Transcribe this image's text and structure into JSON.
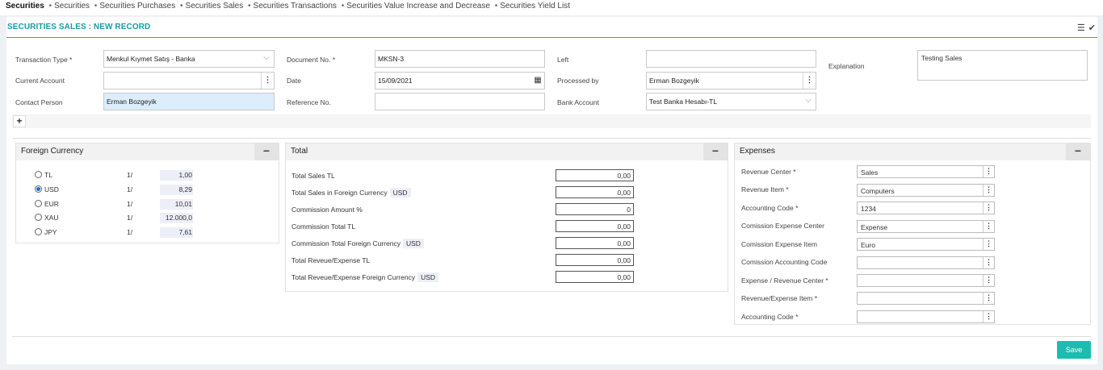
{
  "nav": {
    "first": "Securities",
    "items": [
      "Securities",
      "Securities Purchases",
      "Securities Sales",
      "Securities Transactions",
      "Securities Value Increase and Decrease",
      "Securities Yield List"
    ]
  },
  "page": {
    "title": "SECURITIES SALES : NEW RECORD"
  },
  "form": {
    "transaction_type_label": "Transaction Type *",
    "transaction_type_value": "Menkul Kıymet Satış - Banka",
    "current_account_label": "Current Account",
    "current_account_value": "",
    "contact_person_label": "Contact Person",
    "contact_person_value": "Erman Bozgeyik",
    "document_no_label": "Document No. *",
    "document_no_value": "MKSN-3",
    "date_label": "Date",
    "date_value": "15/09/2021",
    "reference_no_label": "Reference No.",
    "reference_no_value": "",
    "left_label": "Left",
    "left_value": "",
    "processed_by_label": "Processed by",
    "processed_by_value": "Erman Bozgeyik",
    "bank_account_label": "Bank Account",
    "bank_account_value": "Test Banka Hesabı-TL",
    "explanation_label": "Explanation",
    "explanation_value": "Testing Sales"
  },
  "foreign_currency": {
    "title": "Foreign Currency",
    "rows": [
      {
        "code": "TL",
        "unit": "1/",
        "value": "1,00",
        "selected": false
      },
      {
        "code": "USD",
        "unit": "1/",
        "value": "8,29",
        "selected": true
      },
      {
        "code": "EUR",
        "unit": "1/",
        "value": "10,01",
        "selected": false
      },
      {
        "code": "XAU",
        "unit": "1/",
        "value": "12.000,0",
        "selected": false
      },
      {
        "code": "JPY",
        "unit": "1/",
        "value": "7,61",
        "selected": false
      }
    ]
  },
  "total": {
    "title": "Total",
    "rows": [
      {
        "label": "Total Sales TL",
        "currency": "",
        "value": "0,00"
      },
      {
        "label": "Total Sales in Foreign Currency",
        "currency": "USD",
        "value": "0,00"
      },
      {
        "label": "Commission Amount %",
        "currency": "",
        "value": "0"
      },
      {
        "label": "Commission Total TL",
        "currency": "",
        "value": "0,00"
      },
      {
        "label": "Commission Total Foreign Currency",
        "currency": "USD",
        "value": "0,00"
      },
      {
        "label": "Total Reveue/Expense TL",
        "currency": "",
        "value": "0,00"
      },
      {
        "label": "Total Reveue/Expense Foreign Currency",
        "currency": "USD",
        "value": "0,00"
      }
    ]
  },
  "expenses": {
    "title": "Expenses",
    "rows": [
      {
        "label": "Revenue Center *",
        "value": "Sales"
      },
      {
        "label": "Revenue Item *",
        "value": "Computers"
      },
      {
        "label": "Accounting Code *",
        "value": "1234"
      },
      {
        "label": "Comission Expense Center",
        "value": "Expense"
      },
      {
        "label": "Comission Expense Item",
        "value": "Euro"
      },
      {
        "label": "Comission Accounting Code",
        "value": ""
      },
      {
        "label": "Expense / Revenue Center *",
        "value": ""
      },
      {
        "label": "Revenue/Expense Item *",
        "value": ""
      },
      {
        "label": "Accounting Code *",
        "value": ""
      }
    ]
  },
  "actions": {
    "save": "Save"
  },
  "icons": {
    "menu": "list-icon",
    "check": "check-icon",
    "more": "vertical-dots-icon",
    "calendar": "calendar-icon",
    "plus": "plus-icon",
    "minus": "minus-icon",
    "chevron": "chevron-down-icon"
  },
  "colors": {
    "accent": "#1fb1a6",
    "title": "#1b9aa6",
    "save": "#1cbcb0",
    "highlight": "#dceefc"
  }
}
